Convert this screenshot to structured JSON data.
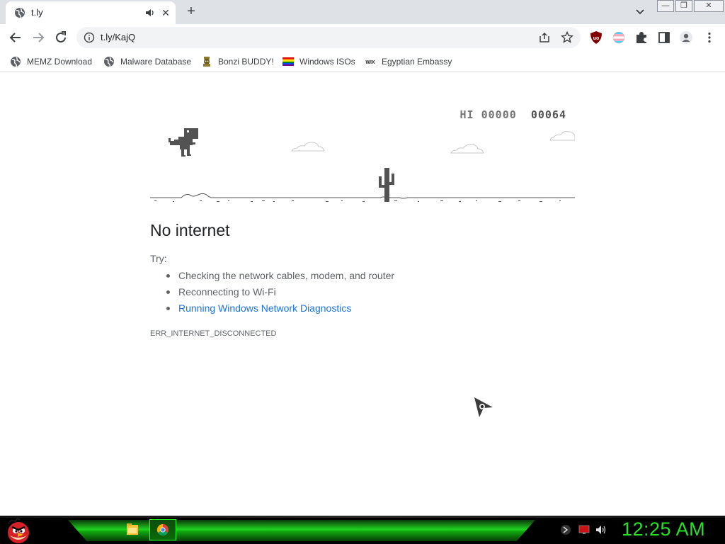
{
  "browser": {
    "tab": {
      "title": "t.ly"
    },
    "window_buttons": {
      "minimize": "—",
      "restore": "❐",
      "close": "✕"
    },
    "new_tab_label": "+",
    "omnibox": {
      "url": "t.ly/KajQ"
    },
    "bookmarks": [
      {
        "label": "MEMZ Download",
        "icon": "globe-icon"
      },
      {
        "label": "Malware Database",
        "icon": "globe-icon"
      },
      {
        "label": "Bonzi BUDDY!",
        "icon": "bonzi-icon"
      },
      {
        "label": "Windows ISOs",
        "icon": "rainbow-flag-icon"
      },
      {
        "label": "Egyptian Embassy",
        "icon": "wix-icon"
      }
    ]
  },
  "page": {
    "game": {
      "hi_label": "HI",
      "hi_score": "00000",
      "score": "00064"
    },
    "title": "No internet",
    "try_label": "Try:",
    "suggestions": [
      "Checking the network cables, modem, and router",
      "Reconnecting to Wi-Fi",
      "Running Windows Network Diagnostics"
    ],
    "error_code": "ERR_INTERNET_DISCONNECTED"
  },
  "taskbar": {
    "clock": "12:25 AM",
    "accent": "#25e225"
  },
  "colors": {
    "link": "#1a73e8",
    "text": "#202124",
    "muted": "#5f6368",
    "dino": "#535353"
  }
}
